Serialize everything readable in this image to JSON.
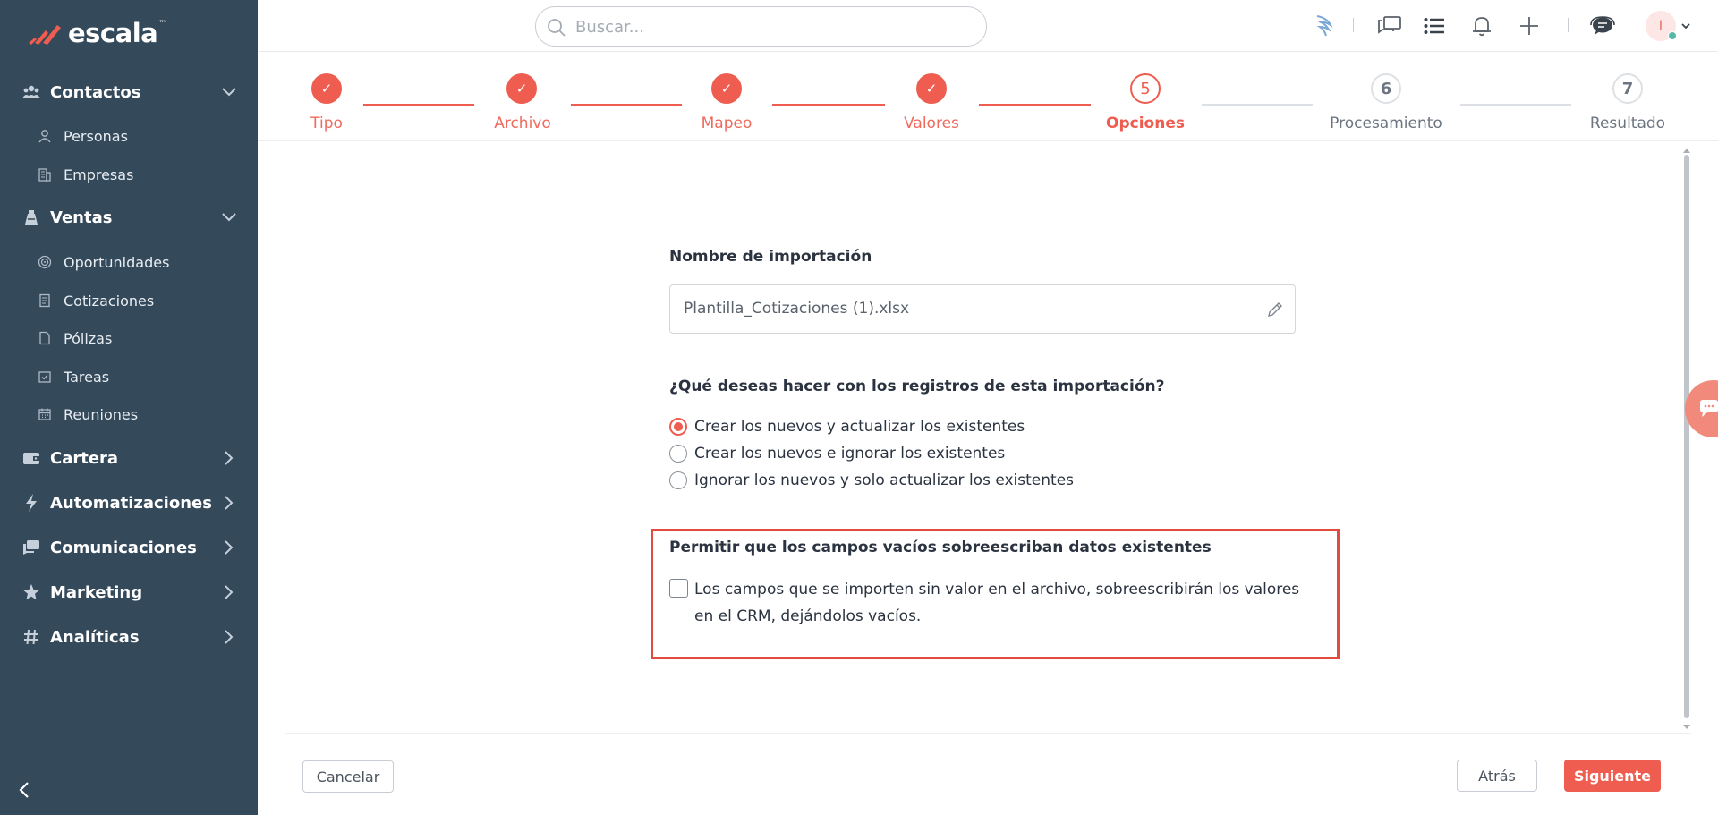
{
  "brand": {
    "name": "escala",
    "tm": "™"
  },
  "sidebar": {
    "sections": [
      {
        "label": "Contactos",
        "icon": "contacts-icon",
        "expanded": true,
        "items": [
          {
            "label": "Personas",
            "icon": "person-icon"
          },
          {
            "label": "Empresas",
            "icon": "building-icon"
          }
        ]
      },
      {
        "label": "Ventas",
        "icon": "sales-icon",
        "expanded": true,
        "items": [
          {
            "label": "Oportunidades",
            "icon": "target-icon"
          },
          {
            "label": "Cotizaciones",
            "icon": "quote-icon"
          },
          {
            "label": "Pólizas",
            "icon": "file-icon"
          },
          {
            "label": "Tareas",
            "icon": "task-icon"
          },
          {
            "label": "Reuniones",
            "icon": "calendar-icon"
          }
        ]
      },
      {
        "label": "Cartera",
        "icon": "wallet-icon",
        "expanded": false
      },
      {
        "label": "Automatizaciones",
        "icon": "bolt-icon",
        "expanded": false
      },
      {
        "label": "Comunicaciones",
        "icon": "chat-icon",
        "expanded": false
      },
      {
        "label": "Marketing",
        "icon": "star-icon",
        "expanded": false
      },
      {
        "label": "Analíticas",
        "icon": "hash-icon",
        "expanded": false
      }
    ]
  },
  "header": {
    "search_placeholder": "Buscar...",
    "avatar_initial": "I"
  },
  "stepper": {
    "steps": [
      {
        "label": "Tipo",
        "status": "done",
        "number": "1"
      },
      {
        "label": "Archivo",
        "status": "done",
        "number": "2"
      },
      {
        "label": "Mapeo",
        "status": "done",
        "number": "3"
      },
      {
        "label": "Valores",
        "status": "done",
        "number": "4"
      },
      {
        "label": "Opciones",
        "status": "active",
        "number": "5"
      },
      {
        "label": "Procesamiento",
        "status": "pending",
        "number": "6"
      },
      {
        "label": "Resultado",
        "status": "pending",
        "number": "7"
      }
    ],
    "check_glyph": "✓"
  },
  "form": {
    "name_label": "Nombre de importación",
    "name_value": "Plantilla_Cotizaciones (1).xlsx",
    "records_question": "¿Qué deseas hacer con los registros de esta importación?",
    "options": [
      {
        "label": "Crear los nuevos y actualizar los existentes",
        "selected": true
      },
      {
        "label": "Crear los nuevos e ignorar los existentes",
        "selected": false
      },
      {
        "label": "Ignorar los nuevos y solo actualizar los existentes",
        "selected": false
      }
    ],
    "empty_fields_label": "Permitir que los campos vacíos sobreescriban datos existentes",
    "empty_fields_checkbox": "Los campos que se importen sin valor en el archivo, sobreescribirán los valores en el CRM, dejándolos vacíos.",
    "empty_fields_checked": false
  },
  "footer": {
    "cancel": "Cancelar",
    "back": "Atrás",
    "next": "Siguiente"
  },
  "colors": {
    "accent": "#ee5d4f",
    "sidebar": "#34495a",
    "highlight": "#e24b3f"
  }
}
